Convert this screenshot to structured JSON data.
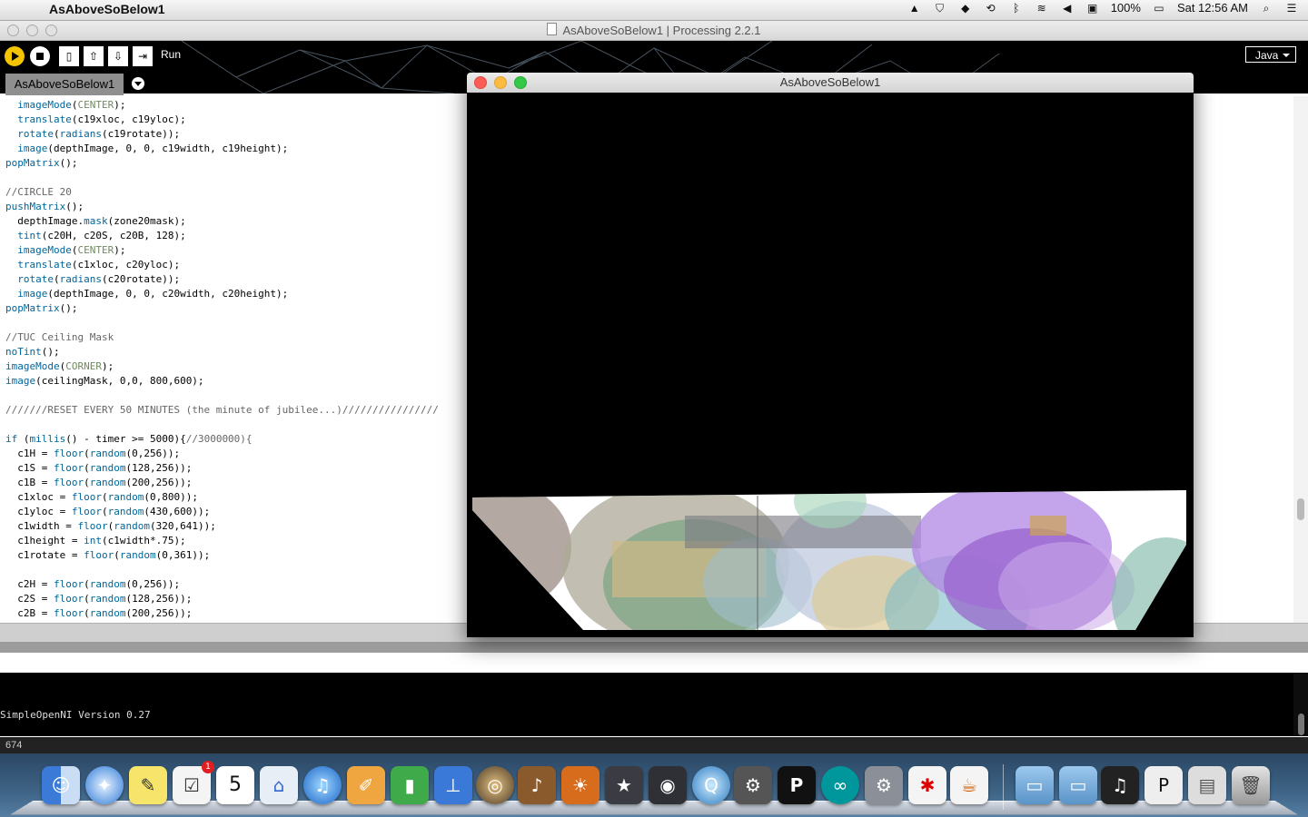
{
  "menubar": {
    "app_name": "AsAboveSoBelow1",
    "battery": "100%",
    "clock": "Sat 12:56 AM",
    "icons": [
      "flux-icon",
      "shield-icon",
      "dropbox-icon",
      "time-machine-icon",
      "bluetooth-icon",
      "wifi-icon",
      "volume-icon",
      "screen-icon",
      "battery-icon",
      "spotlight-icon",
      "notification-center-icon"
    ]
  },
  "window": {
    "title": "AsAboveSoBelow1 | Processing 2.2.1"
  },
  "toolbar": {
    "run_label": "Run",
    "mode": "Java",
    "buttons": [
      "run-button",
      "stop-button",
      "new-button",
      "open-button",
      "save-button",
      "export-button"
    ]
  },
  "tabs": {
    "active": "AsAboveSoBelow1"
  },
  "code_lines": [
    "  imageMode(CENTER);",
    "  translate(c19xloc, c19yloc);",
    "  rotate(radians(c19rotate));",
    "  image(depthImage, 0, 0, c19width, c19height);",
    "popMatrix();",
    "",
    "//CIRCLE 20",
    "pushMatrix();",
    "  depthImage.mask(zone20mask);",
    "  tint(c20H, c20S, c20B, 128);",
    "  imageMode(CENTER);",
    "  translate(c1xloc, c20yloc);",
    "  rotate(radians(c20rotate));",
    "  image(depthImage, 0, 0, c20width, c20height);",
    "popMatrix();",
    "",
    "//TUC Ceiling Mask",
    "noTint();",
    "imageMode(CORNER);",
    "image(ceilingMask, 0,0, 800,600);",
    "",
    "///////RESET EVERY 50 MINUTES (the minute of jubilee...)////////////////",
    "",
    "if (millis() - timer >= 5000){//3000000){",
    "  c1H = floor(random(0,256));",
    "  c1S = floor(random(128,256));",
    "  c1B = floor(random(200,256));",
    "  c1xloc = floor(random(0,800));",
    "  c1yloc = floor(random(430,600));",
    "  c1width = floor(random(320,641));",
    "  c1height = int(c1width*.75);",
    "  c1rotate = floor(random(0,361));",
    "",
    "  c2H = floor(random(0,256));",
    "  c2S = floor(random(128,256));",
    "  c2B = floor(random(200,256));"
  ],
  "console": {
    "output": "SimpleOpenNI Version 0.27",
    "line_number": "674"
  },
  "sketch": {
    "title": "AsAboveSoBelow1"
  },
  "dock": {
    "apps": [
      "finder-icon",
      "safari-icon",
      "stickies-icon",
      "reminders-icon",
      "calendar-icon",
      "preview-icon",
      "itunes-icon",
      "pages-icon",
      "numbers-icon",
      "keynote-icon",
      "aperture-icon",
      "garageband-icon",
      "iphoto-icon",
      "imovie-icon",
      "final-cut-icon",
      "quicktime-icon",
      "disk-utility-icon",
      "processing-icon",
      "arduino-icon",
      "system-preferences-icon",
      "acrobat-icon",
      "java-icon",
      "folder-icon",
      "downloads-icon",
      "music-icon",
      "processing-doc-icon",
      "documents-icon",
      "trash-icon"
    ],
    "calendar_day": "5",
    "reminders_badge": "1"
  },
  "colors": {
    "keyword": "#006699",
    "function": "#33997e",
    "comment": "#666666",
    "constant": "#718a62",
    "run_button": "#f5c400"
  }
}
